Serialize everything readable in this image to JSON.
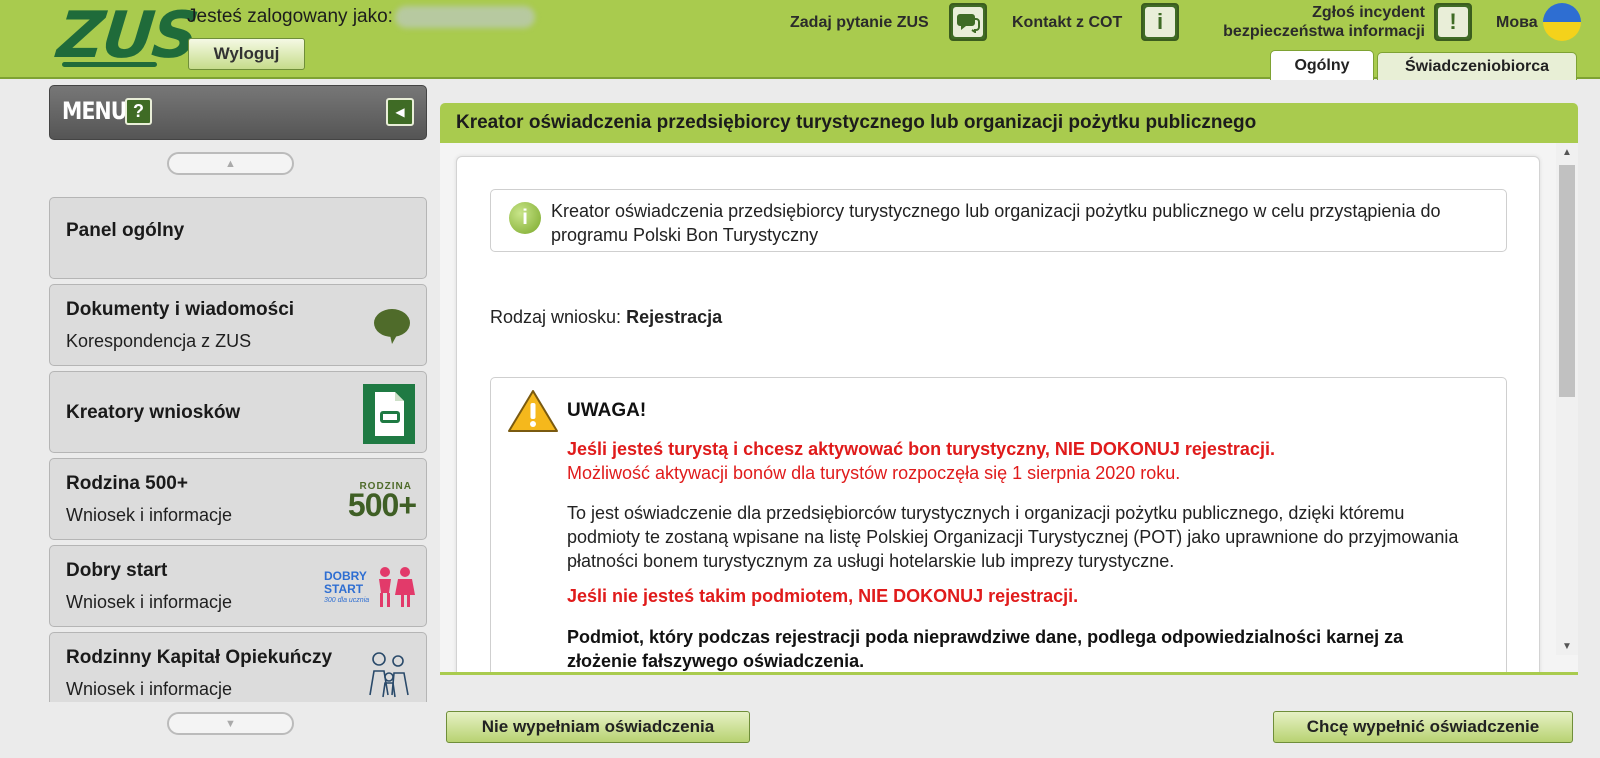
{
  "header": {
    "logo_text": "ZUS",
    "logged_in_label": "Jesteś zalogowany jako:",
    "logout_label": "Wyloguj",
    "ask_zus_label": "Zadaj pytanie ZUS",
    "contact_cot_label": "Kontakt z COT",
    "incident_label_line1": "Zgłoś incydent",
    "incident_label_line2": "bezpieczeństwa informacji",
    "language_label": "Мова",
    "tabs": [
      {
        "label": "Ogólny",
        "active": true
      },
      {
        "label": "Świadczeniobiorca",
        "active": false
      }
    ]
  },
  "sidebar": {
    "menu_label": "MENU",
    "help_label": "?",
    "items": [
      {
        "title": "Panel ogólny",
        "subtitle": ""
      },
      {
        "title": "Dokumenty i wiadomości",
        "subtitle": "Korespondencja z ZUS",
        "icon": "speech-bubble-icon"
      },
      {
        "title": "Kreatory wniosków",
        "subtitle": "",
        "icon": "document-icon"
      },
      {
        "title": "Rodzina 500+",
        "subtitle": "Wniosek i informacje",
        "icon": "rodzina-500-logo",
        "logo_text_small": "RODZINA",
        "logo_text_big": "500+"
      },
      {
        "title": "Dobry start",
        "subtitle": "Wniosek i informacje",
        "icon": "dobry-start-logo",
        "logo_text_1": "DOBRY",
        "logo_text_2": "START",
        "logo_text_3": "300 dla ucznia"
      },
      {
        "title": "Rodzinny Kapitał Opiekuńczy",
        "subtitle": "Wniosek i informacje",
        "icon": "family-icon"
      }
    ]
  },
  "main": {
    "title": "Kreator oświadczenia przedsiębiorcy turystycznego lub organizacji pożytku publicznego",
    "info_text": "Kreator oświadczenia przedsiębiorcy turystycznego lub organizacji pożytku publicznego w celu przystąpienia do programu Polski Bon Turystyczny",
    "request_type_label": "Rodzaj wniosku:",
    "request_type_value": "Rejestracja",
    "warning": {
      "title": "UWAGA!",
      "red_bold": "Jeśli jesteś turystą i chcesz aktywować bon turystyczny, NIE DOKONUJ rejestracji.",
      "red": "Możliwość aktywacji bonów dla turystów rozpoczęła się 1 sierpnia 2020 roku.",
      "text": "To jest oświadczenie dla przedsiębiorców turystycznych i organizacji pożytku publicznego, dzięki któremu podmioty te zostaną wpisane na listę Polskiej Organizacji Turystycznej (POT) jako uprawnione do przyjmowania płatności bonem turystycznym za usługi hotelarskie lub imprezy turystyczne.",
      "red_bold_2": "Jeśli nie jesteś takim podmiotem, NIE DOKONUJ rejestracji.",
      "bold": "Podmiot, który podczas rejestracji poda nieprawdziwe dane, podlega odpowiedzialności karnej za złożenie fałszywego oświadczenia."
    }
  },
  "footer": {
    "decline_label": "Nie wypełniam oświadczenia",
    "accept_label": "Chcę wypełnić oświadczenie"
  },
  "colors": {
    "header_green": "#a9cb4e",
    "dark_green": "#3f6b25",
    "logo_green": "#1f6b3a",
    "warning_red": "#e01b1b"
  }
}
